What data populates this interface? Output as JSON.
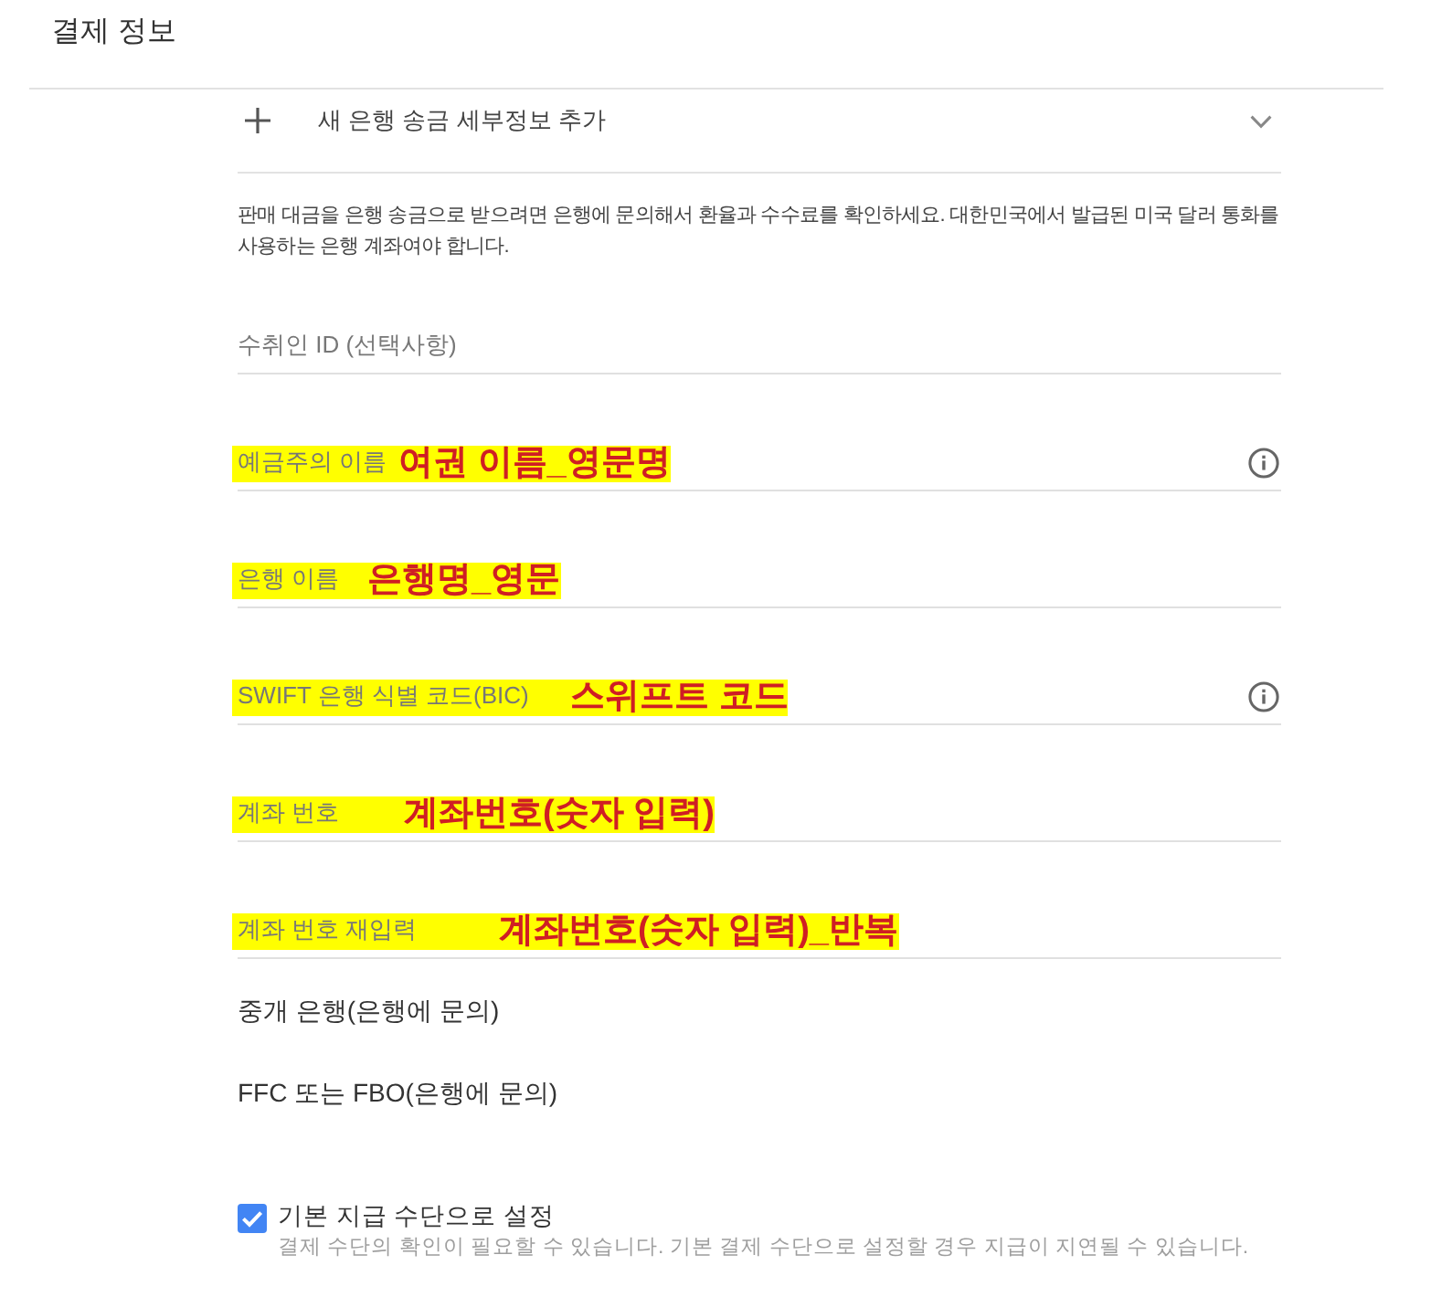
{
  "header": {
    "title": "결제 정보"
  },
  "bank_transfer": {
    "title": "새 은행 송금 세부정보 추가"
  },
  "notice": "판매 대금을 은행 송금으로 받으려면 은행에 문의해서 환율과 수수료를 확인하세요. 대한민국에서 발급된 미국 달러 통화를 사용하는 은행 계좌여야 합니다.",
  "fields": [
    {
      "placeholder": "수취인 ID (선택사항)",
      "highlighted": false,
      "info": false
    },
    {
      "placeholder": "예금주의 이름",
      "highlighted": true,
      "annotation": "여권 이름_영문명",
      "info": true
    },
    {
      "placeholder": "은행 이름",
      "highlighted": true,
      "annotation": "은행명_영문",
      "info": false
    },
    {
      "placeholder": "SWIFT 은행 식별 코드(BIC)",
      "highlighted": true,
      "annotation": "스위프트 코드",
      "info": true
    },
    {
      "placeholder": "계좌 번호",
      "highlighted": true,
      "annotation": "계좌번호(숫자 입력)",
      "info": false
    },
    {
      "placeholder": "계좌 번호 재입력",
      "highlighted": true,
      "annotation": "계좌번호(숫자 입력)_반복",
      "info": false
    }
  ],
  "optional_links": [
    "중개 은행(은행에 문의)",
    "FFC 또는 FBO(은행에 문의)"
  ],
  "default_payment": {
    "label": "기본 지급 수단으로 설정",
    "note": "결제 수단의 확인이 필요할 수 있습니다. 기본 결제 수단으로 설정할 경우 지급이 지연될 수 있습니다.",
    "checked": true
  }
}
